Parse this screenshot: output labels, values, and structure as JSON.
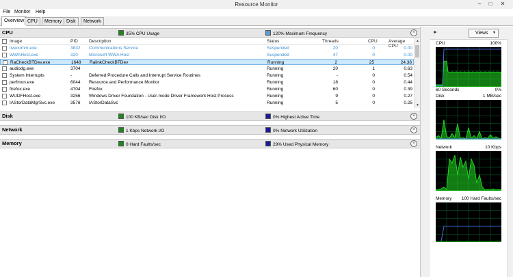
{
  "window": {
    "title": "Resource Monitor"
  },
  "menu": [
    "File",
    "Monitor",
    "Help"
  ],
  "tabs": [
    "Overview",
    "CPU",
    "Memory",
    "Disk",
    "Network"
  ],
  "cpu": {
    "title": "CPU",
    "usage": "35% CPU Usage",
    "frequency": "120% Maximum Frequency",
    "columns": [
      "Image",
      "PID",
      "Description",
      "Status",
      "Threads",
      "CPU",
      "Average CPU"
    ],
    "rows": [
      {
        "image": "livecomm.exe",
        "pid": "3832",
        "desc": "Communications Service",
        "status": "Suspended",
        "threads": "20",
        "cpu": "0",
        "avg": "0.00"
      },
      {
        "image": "WWAHost.exe",
        "pid": "320",
        "desc": "Microsoft WWA Host",
        "status": "Suspended",
        "threads": "47",
        "cpu": "0",
        "avg": "0.00"
      },
      {
        "image": "RaCheckBTDev.exe",
        "pid": "1648",
        "desc": "RalinkCheckBTDev",
        "status": "Running",
        "threads": "2",
        "cpu": "25",
        "avg": "24.38"
      },
      {
        "image": "audiodg.exe",
        "pid": "3704",
        "desc": "",
        "status": "Running",
        "threads": "20",
        "cpu": "1",
        "avg": "0.63"
      },
      {
        "image": "System Interrupts",
        "pid": "-",
        "desc": "Deferred Procedure Calls and Interrupt Service Routines",
        "status": "Running",
        "threads": "-",
        "cpu": "0",
        "avg": "0.54"
      },
      {
        "image": "perfmon.exe",
        "pid": "6044",
        "desc": "Resource and Performance Monitor",
        "status": "Running",
        "threads": "18",
        "cpu": "0",
        "avg": "0.44"
      },
      {
        "image": "firefox.exe",
        "pid": "4704",
        "desc": "Firefox",
        "status": "Running",
        "threads": "60",
        "cpu": "0",
        "avg": "0.39"
      },
      {
        "image": "WUDFHost.exe",
        "pid": "3256",
        "desc": "Windows Driver Foundation - User-mode Driver Framework Host Process",
        "status": "Running",
        "threads": "9",
        "cpu": "0",
        "avg": "0.27"
      },
      {
        "image": "IAStorDataMgrSvc.exe",
        "pid": "3576",
        "desc": "IAStorDataSvc",
        "status": "Running",
        "threads": "5",
        "cpu": "0",
        "avg": "0.25"
      }
    ]
  },
  "disk": {
    "title": "Disk",
    "io": "100 KB/sec Disk I/O",
    "active": "0% Highest Active Time"
  },
  "network": {
    "title": "Network",
    "io": "1 Kbps Network I/O",
    "util": "0% Network Utilization"
  },
  "memory": {
    "title": "Memory",
    "faults": "0 Hard Faults/sec",
    "used": "29% Used Physical Memory"
  },
  "right": {
    "views": "Views",
    "graphs": [
      {
        "name": "CPU",
        "max": "100%",
        "footer_left": "60 Seconds",
        "footer_right": "0%"
      },
      {
        "name": "Disk",
        "max": "1 MB/sec",
        "footer_left": "",
        "footer_right": ""
      },
      {
        "name": "Network",
        "max": "10 Kbps",
        "footer_left": "",
        "footer_right": ""
      },
      {
        "name": "Memory",
        "max": "100 Hard Faults/sec",
        "footer_left": "",
        "footer_right": ""
      }
    ]
  },
  "colors": {
    "cpu_usage": "#1a8a1a",
    "cpu_freq": "#5b9bd5",
    "disk_io": "#1a8a1a",
    "disk_active": "#1a1a9a",
    "net_io": "#1a8a1a",
    "net_util": "#1a1a9a",
    "mem_faults": "#1a8a1a",
    "mem_used": "#1a1a9a",
    "graph_bg": "#000000",
    "graph_grid": "#0b5a2a",
    "graph_green": "#22e022",
    "graph_blue": "#4a7bff"
  }
}
